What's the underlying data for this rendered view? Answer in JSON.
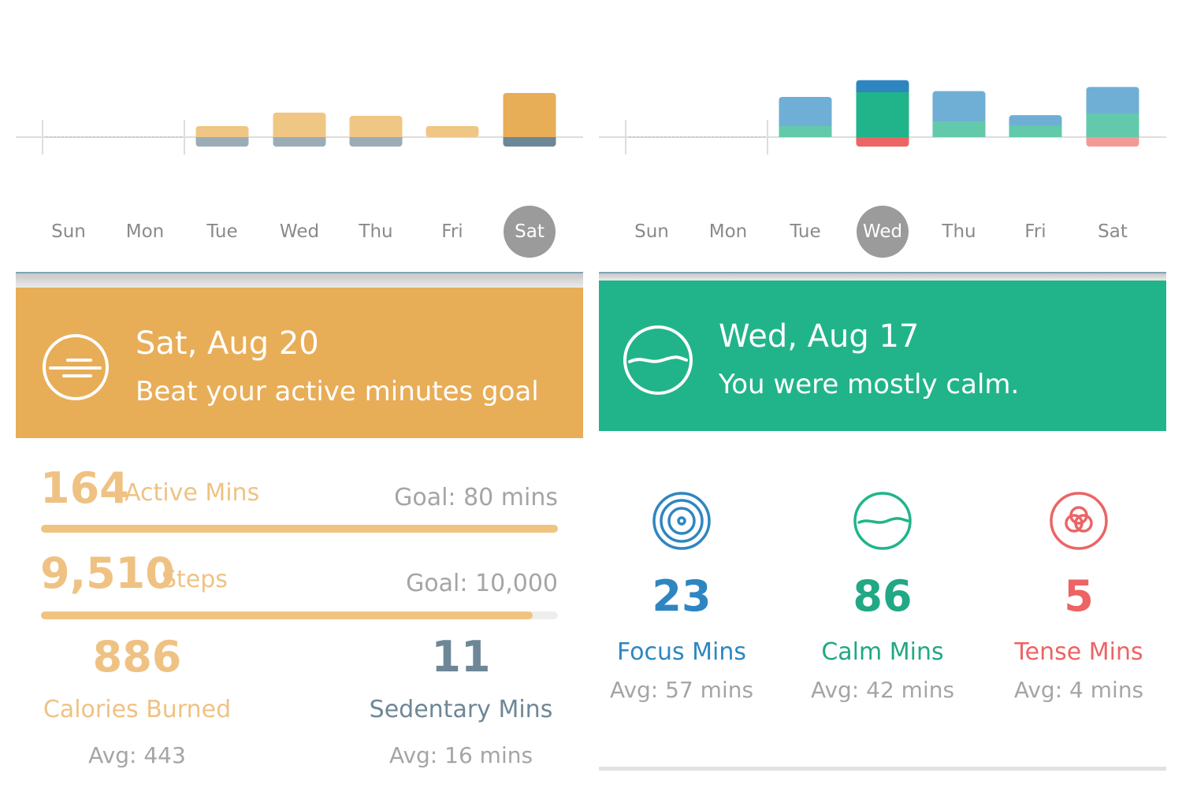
{
  "colors": {
    "activity": "#E8AD57",
    "activity_light": "#F0C684",
    "sedentary": "#9AADB7",
    "sedentary_dark": "#6E8796",
    "focus": "#2E86C1",
    "focus_light": "#6FAFD6",
    "calm": "#21B48A",
    "calm_light": "#62CAAA",
    "tense": "#EC6464",
    "tense_light": "#F19A98"
  },
  "left": {
    "days": [
      "Sun",
      "Mon",
      "Tue",
      "Wed",
      "Thu",
      "Fri",
      "Sat"
    ],
    "selected_day": "Sat",
    "chart_data": {
      "type": "bar",
      "categories": [
        "Sun",
        "Mon",
        "Tue",
        "Wed",
        "Thu",
        "Fri",
        "Sat"
      ],
      "series": [
        {
          "values": [
            0,
            0,
            41,
            91,
            79,
            41,
            164
          ]
        },
        {
          "values": [
            0,
            0,
            12,
            12,
            12,
            0,
            11
          ]
        }
      ]
    },
    "banner": {
      "icon": "activity-lines-icon",
      "title": "Sat, Aug 20",
      "subtitle": "Beat your active minutes goal"
    },
    "active": {
      "value": "164",
      "label": "Active Mins",
      "goal": "Goal: 80 mins",
      "progress": 1.0
    },
    "steps": {
      "value": "9,510",
      "label": "Steps",
      "goal": "Goal: 10,000",
      "progress": 0.951
    },
    "calories": {
      "value": "886",
      "label": "Calories Burned",
      "avg": "Avg: 443"
    },
    "sedentary": {
      "value": "11",
      "label": "Sedentary Mins",
      "avg": "Avg: 16 mins"
    }
  },
  "right": {
    "days": [
      "Sun",
      "Mon",
      "Tue",
      "Wed",
      "Thu",
      "Fri",
      "Sat"
    ],
    "selected_day": "Wed",
    "chart_data": {
      "type": "bar",
      "categories": [
        "Sun",
        "Mon",
        "Tue",
        "Wed",
        "Thu",
        "Fri",
        "Sat"
      ],
      "series": [
        {
          "values": [
            0,
            0,
            56,
            23,
            58,
            20,
            51
          ]
        },
        {
          "values": [
            0,
            0,
            21,
            86,
            30,
            22,
            45
          ]
        },
        {
          "values": [
            0,
            0,
            0,
            5,
            0,
            0,
            4
          ]
        }
      ]
    },
    "banner": {
      "icon": "calm-wave-icon",
      "title": "Wed, Aug 17",
      "subtitle": "You were mostly calm."
    },
    "stats": [
      {
        "icon": "focus-target-icon",
        "value": "23",
        "label": "Focus Mins",
        "avg": "Avg: 57 mins"
      },
      {
        "icon": "calm-wave-icon",
        "value": "86",
        "label": "Calm Mins",
        "avg": "Avg: 42 mins"
      },
      {
        "icon": "tense-rings-icon",
        "value": "5",
        "label": "Tense Mins",
        "avg": "Avg: 4 mins"
      }
    ]
  }
}
